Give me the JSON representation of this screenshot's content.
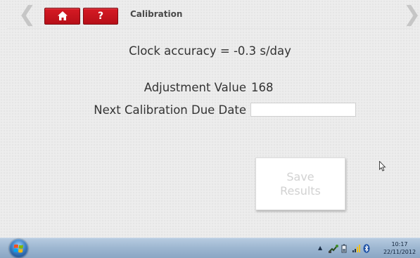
{
  "header": {
    "title": "Calibration",
    "help_label": "?",
    "prev_arrow": "❮",
    "next_arrow": "❯",
    "home_icon": "home-icon",
    "button_color": "#c8141e"
  },
  "main": {
    "clock_accuracy": "Clock accuracy = -0.3 s/day",
    "adjustment_label": "Adjustment Value",
    "adjustment_value": "168",
    "due_date_label": "Next Calibration Due Date",
    "due_date_value": "",
    "save_button_label": "Save\nResults"
  },
  "taskbar": {
    "start_icon": "windows-start-icon",
    "tray_icons": [
      "show-hidden-icons-chevron",
      "network-icon",
      "battery-icon",
      "signal-icon",
      "bluetooth-icon"
    ],
    "chevron": "▲",
    "time": "10:17",
    "date": "22/11/2012"
  }
}
